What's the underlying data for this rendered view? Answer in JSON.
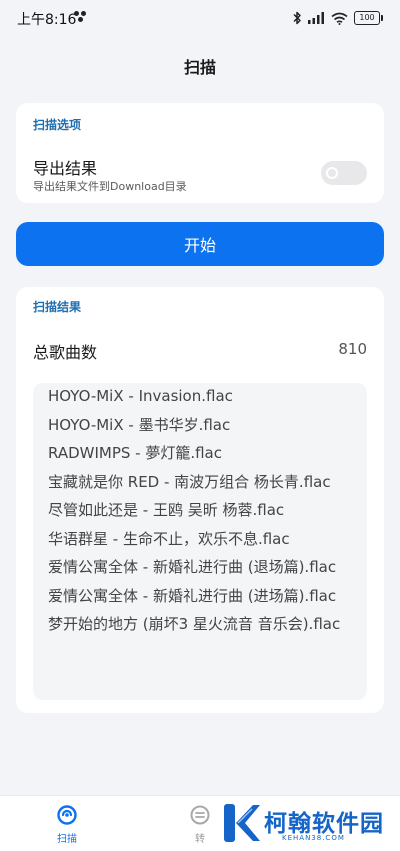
{
  "status_bar": {
    "time": "上午8:16",
    "battery": "100",
    "icons": [
      "notification-dots-icon",
      "bluetooth-icon",
      "signal-icon",
      "wifi-icon",
      "battery-icon"
    ]
  },
  "header": {
    "title": "扫描"
  },
  "scan_options": {
    "section_label": "扫描选项",
    "export_title": "导出结果",
    "export_subtitle": "导出结果文件到Download目录",
    "export_enabled": false
  },
  "start_button": {
    "label": "开始"
  },
  "scan_results": {
    "section_label": "扫描结果",
    "total_label": "总歌曲数",
    "total_value": "810",
    "songs": [
      "HOYO-MiX - Invasion.flac",
      "HOYO-MiX - 墨书华岁.flac",
      "RADWIMPS - 夢灯籠.flac",
      "宝藏就是你 RED - 南波万组合 杨长青.flac",
      "尽管如此还是 - 王鸥 吴昕 杨蓉.flac",
      "华语群星 - 生命不止，欢乐不息.flac",
      "爱情公寓全体 - 新婚礼进行曲 (退场篇).flac",
      "爱情公寓全体 - 新婚礼进行曲 (进场篇).flac",
      "梦开始的地方 (崩坏3 星火流音 音乐会).flac"
    ]
  },
  "bottom_nav": {
    "items": [
      {
        "label": "扫描",
        "icon": "scan-icon",
        "active": true
      },
      {
        "label": "转",
        "icon": "convert-icon",
        "active": false
      }
    ]
  },
  "watermark": {
    "title": "柯翰软件园",
    "domain": "KEHAN38.COM",
    "color": "#1565c8"
  },
  "colors": {
    "accent": "#0d72f0",
    "section_label": "#1f6fb0",
    "background": "#f2f4f8"
  }
}
